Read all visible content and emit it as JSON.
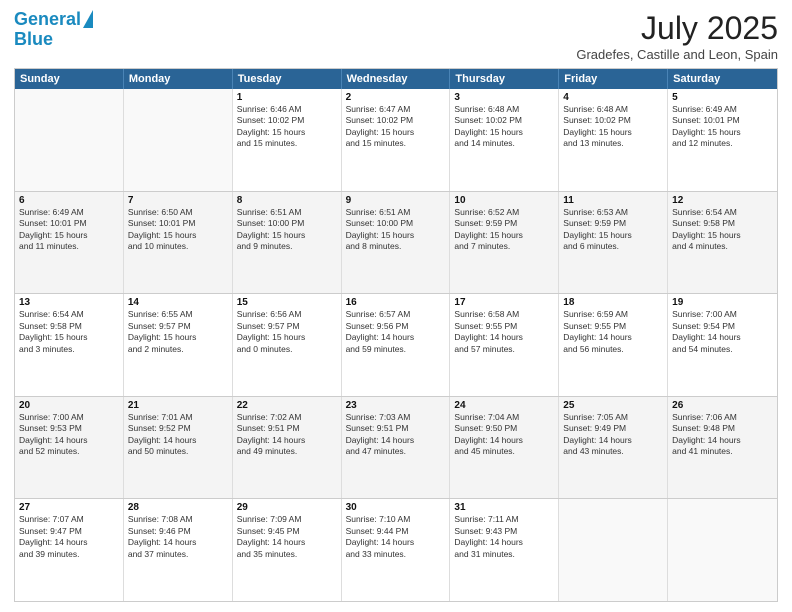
{
  "header": {
    "logo_line1": "General",
    "logo_line2": "Blue",
    "month_year": "July 2025",
    "location": "Gradefes, Castille and Leon, Spain"
  },
  "days_of_week": [
    "Sunday",
    "Monday",
    "Tuesday",
    "Wednesday",
    "Thursday",
    "Friday",
    "Saturday"
  ],
  "weeks": [
    [
      {
        "day": "",
        "info": ""
      },
      {
        "day": "",
        "info": ""
      },
      {
        "day": "1",
        "info": "Sunrise: 6:46 AM\nSunset: 10:02 PM\nDaylight: 15 hours\nand 15 minutes."
      },
      {
        "day": "2",
        "info": "Sunrise: 6:47 AM\nSunset: 10:02 PM\nDaylight: 15 hours\nand 15 minutes."
      },
      {
        "day": "3",
        "info": "Sunrise: 6:48 AM\nSunset: 10:02 PM\nDaylight: 15 hours\nand 14 minutes."
      },
      {
        "day": "4",
        "info": "Sunrise: 6:48 AM\nSunset: 10:02 PM\nDaylight: 15 hours\nand 13 minutes."
      },
      {
        "day": "5",
        "info": "Sunrise: 6:49 AM\nSunset: 10:01 PM\nDaylight: 15 hours\nand 12 minutes."
      }
    ],
    [
      {
        "day": "6",
        "info": "Sunrise: 6:49 AM\nSunset: 10:01 PM\nDaylight: 15 hours\nand 11 minutes."
      },
      {
        "day": "7",
        "info": "Sunrise: 6:50 AM\nSunset: 10:01 PM\nDaylight: 15 hours\nand 10 minutes."
      },
      {
        "day": "8",
        "info": "Sunrise: 6:51 AM\nSunset: 10:00 PM\nDaylight: 15 hours\nand 9 minutes."
      },
      {
        "day": "9",
        "info": "Sunrise: 6:51 AM\nSunset: 10:00 PM\nDaylight: 15 hours\nand 8 minutes."
      },
      {
        "day": "10",
        "info": "Sunrise: 6:52 AM\nSunset: 9:59 PM\nDaylight: 15 hours\nand 7 minutes."
      },
      {
        "day": "11",
        "info": "Sunrise: 6:53 AM\nSunset: 9:59 PM\nDaylight: 15 hours\nand 6 minutes."
      },
      {
        "day": "12",
        "info": "Sunrise: 6:54 AM\nSunset: 9:58 PM\nDaylight: 15 hours\nand 4 minutes."
      }
    ],
    [
      {
        "day": "13",
        "info": "Sunrise: 6:54 AM\nSunset: 9:58 PM\nDaylight: 15 hours\nand 3 minutes."
      },
      {
        "day": "14",
        "info": "Sunrise: 6:55 AM\nSunset: 9:57 PM\nDaylight: 15 hours\nand 2 minutes."
      },
      {
        "day": "15",
        "info": "Sunrise: 6:56 AM\nSunset: 9:57 PM\nDaylight: 15 hours\nand 0 minutes."
      },
      {
        "day": "16",
        "info": "Sunrise: 6:57 AM\nSunset: 9:56 PM\nDaylight: 14 hours\nand 59 minutes."
      },
      {
        "day": "17",
        "info": "Sunrise: 6:58 AM\nSunset: 9:55 PM\nDaylight: 14 hours\nand 57 minutes."
      },
      {
        "day": "18",
        "info": "Sunrise: 6:59 AM\nSunset: 9:55 PM\nDaylight: 14 hours\nand 56 minutes."
      },
      {
        "day": "19",
        "info": "Sunrise: 7:00 AM\nSunset: 9:54 PM\nDaylight: 14 hours\nand 54 minutes."
      }
    ],
    [
      {
        "day": "20",
        "info": "Sunrise: 7:00 AM\nSunset: 9:53 PM\nDaylight: 14 hours\nand 52 minutes."
      },
      {
        "day": "21",
        "info": "Sunrise: 7:01 AM\nSunset: 9:52 PM\nDaylight: 14 hours\nand 50 minutes."
      },
      {
        "day": "22",
        "info": "Sunrise: 7:02 AM\nSunset: 9:51 PM\nDaylight: 14 hours\nand 49 minutes."
      },
      {
        "day": "23",
        "info": "Sunrise: 7:03 AM\nSunset: 9:51 PM\nDaylight: 14 hours\nand 47 minutes."
      },
      {
        "day": "24",
        "info": "Sunrise: 7:04 AM\nSunset: 9:50 PM\nDaylight: 14 hours\nand 45 minutes."
      },
      {
        "day": "25",
        "info": "Sunrise: 7:05 AM\nSunset: 9:49 PM\nDaylight: 14 hours\nand 43 minutes."
      },
      {
        "day": "26",
        "info": "Sunrise: 7:06 AM\nSunset: 9:48 PM\nDaylight: 14 hours\nand 41 minutes."
      }
    ],
    [
      {
        "day": "27",
        "info": "Sunrise: 7:07 AM\nSunset: 9:47 PM\nDaylight: 14 hours\nand 39 minutes."
      },
      {
        "day": "28",
        "info": "Sunrise: 7:08 AM\nSunset: 9:46 PM\nDaylight: 14 hours\nand 37 minutes."
      },
      {
        "day": "29",
        "info": "Sunrise: 7:09 AM\nSunset: 9:45 PM\nDaylight: 14 hours\nand 35 minutes."
      },
      {
        "day": "30",
        "info": "Sunrise: 7:10 AM\nSunset: 9:44 PM\nDaylight: 14 hours\nand 33 minutes."
      },
      {
        "day": "31",
        "info": "Sunrise: 7:11 AM\nSunset: 9:43 PM\nDaylight: 14 hours\nand 31 minutes."
      },
      {
        "day": "",
        "info": ""
      },
      {
        "day": "",
        "info": ""
      }
    ]
  ]
}
